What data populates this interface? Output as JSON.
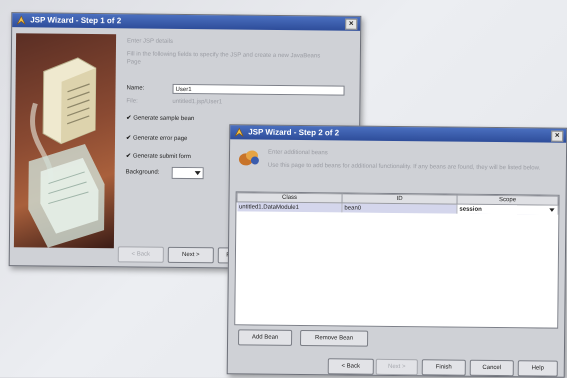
{
  "wizard1": {
    "title": "JSP Wizard - Step 1 of 2",
    "close_glyph": "×",
    "heading": "Enter JSP details",
    "description": "Fill in the following fields to specify the JSP and create a new JavaBeans Page",
    "name_label": "Name:",
    "name_value": "User1",
    "file_label": "File:",
    "file_value": "untitled1.jsp/User1",
    "checks": [
      {
        "label": "Generate sample bean",
        "checked": true
      },
      {
        "label": "Generate error page",
        "checked": true
      },
      {
        "label": "Generate submit form",
        "checked": true
      }
    ],
    "background_label": "Background:",
    "buttons": {
      "back": "< Back",
      "next": "Next >",
      "finish": "Fi"
    }
  },
  "wizard2": {
    "title": "JSP Wizard - Step 2 of 2",
    "close_glyph": "×",
    "heading": "Enter additional beans",
    "description": "Use this page to add beans for additional functionality. If any beans are found, they will be listed below.",
    "table": {
      "columns": [
        "Class",
        "ID",
        "Scope"
      ],
      "rows": [
        {
          "class": "untitled1.DataModule1",
          "id": "bean0",
          "scope": "session"
        }
      ]
    },
    "buttons": {
      "add_bean": "Add Bean",
      "remove_bean": "Remove Bean",
      "back": "< Back",
      "next": "Next >",
      "finish": "Finish",
      "cancel": "Cancel",
      "help": "Help"
    }
  },
  "icons": {
    "title_icon": "wizard-icon",
    "dropdown": "chevron-down-icon"
  },
  "colors": {
    "titlebar": "#3a5cae",
    "dialog": "#cfd1d6",
    "selected_row": "#d4d6ec"
  }
}
